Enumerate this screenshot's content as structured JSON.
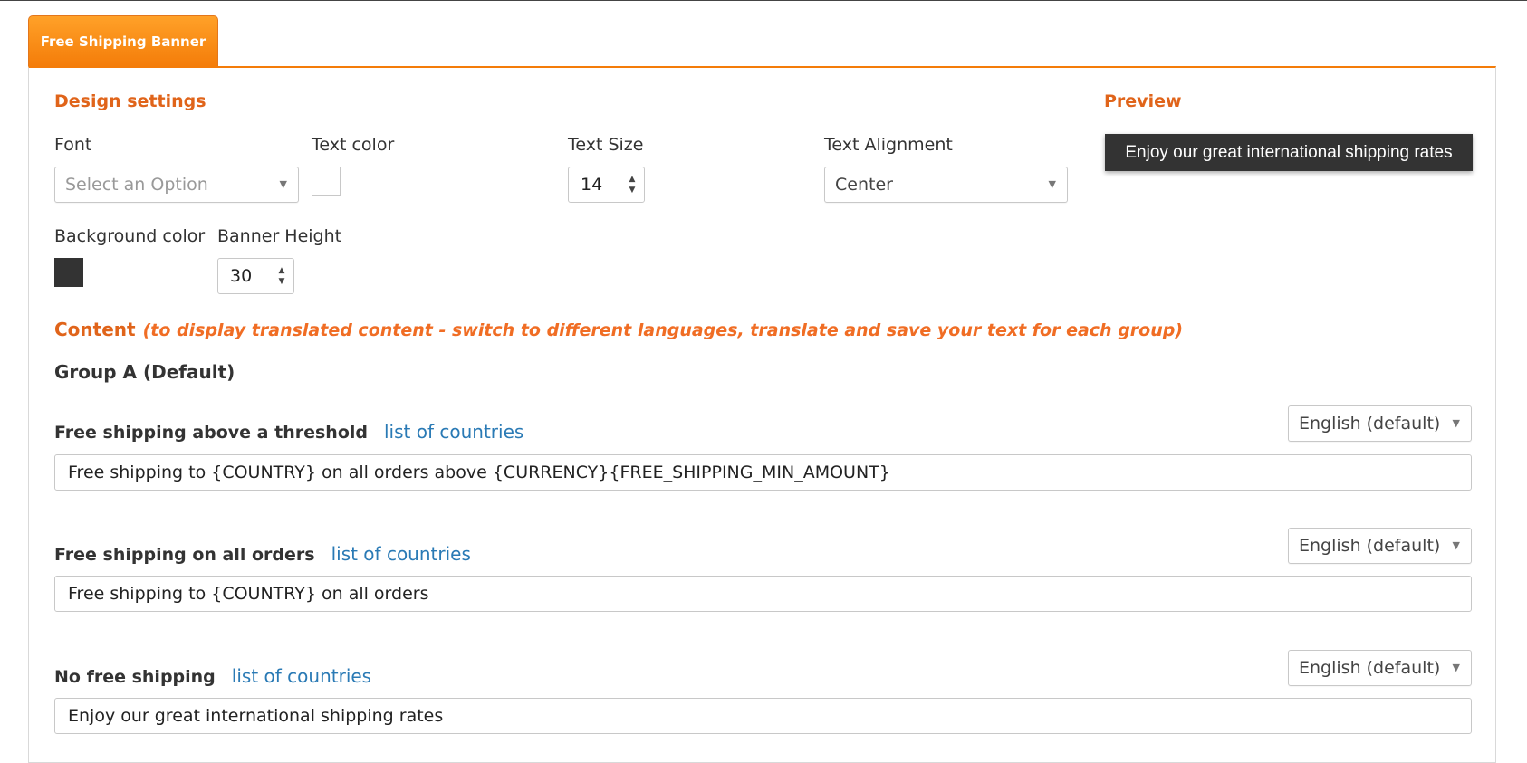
{
  "tab": {
    "label": "Free Shipping Banner"
  },
  "design": {
    "title": "Design settings",
    "font": {
      "label": "Font",
      "placeholder": "Select an Option"
    },
    "text_color": {
      "label": "Text color",
      "value": "#ffffff"
    },
    "text_size": {
      "label": "Text Size",
      "value": "14"
    },
    "text_alignment": {
      "label": "Text Alignment",
      "value": "Center"
    },
    "background_color": {
      "label": "Background color",
      "value": "#333333"
    },
    "banner_height": {
      "label": "Banner Height",
      "value": "30"
    }
  },
  "preview": {
    "title": "Preview",
    "banner_text": "Enjoy our great international shipping rates"
  },
  "content": {
    "title": "Content",
    "note": "(to display translated content - switch to different languages, translate and save your text for each group)",
    "group_title": "Group A (Default)",
    "rows": [
      {
        "label": "Free shipping above a threshold",
        "link": "list of countries",
        "language": "English (default)",
        "text": "Free shipping to {COUNTRY} on all orders above {CURRENCY}{FREE_SHIPPING_MIN_AMOUNT}"
      },
      {
        "label": "Free shipping on all orders",
        "link": "list of countries",
        "language": "English (default)",
        "text": "Free shipping to {COUNTRY} on all orders"
      },
      {
        "label": "No free shipping",
        "link": "list of countries",
        "language": "English (default)",
        "text": "Enjoy our great international shipping rates"
      }
    ]
  },
  "colors": {
    "accent": "#f47c09",
    "heading": "#e0641a",
    "link": "#2a7ab5"
  }
}
